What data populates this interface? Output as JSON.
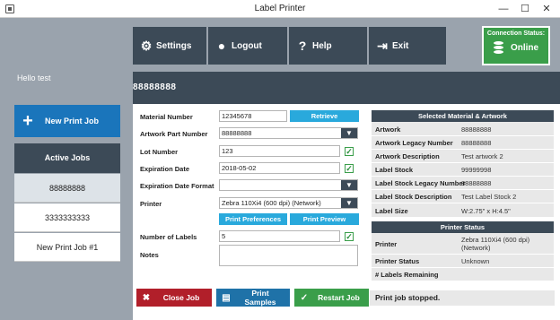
{
  "window": {
    "title": "Label Printer",
    "minimize": "—",
    "maximize": "☐",
    "close": "✕"
  },
  "sidebar": {
    "greeting": "Hello test",
    "new_job_label": "New Print Job",
    "active_jobs_title": "Active Jobs",
    "jobs": [
      "88888888",
      "3333333333",
      "New Print Job #1"
    ]
  },
  "toolbar": {
    "settings": "Settings",
    "logout": "Logout",
    "help": "Help",
    "exit": "Exit"
  },
  "connection": {
    "caption": "Connection Status:",
    "status": "Online",
    "color": "#3a9e4a"
  },
  "job_header": "88888888",
  "form": {
    "material_number": {
      "label": "Material Number",
      "value": "12345678",
      "button": "Retrieve"
    },
    "artwork_part_number": {
      "label": "Artwork Part Number",
      "value": "88888888"
    },
    "lot_number": {
      "label": "Lot Number",
      "value": "123"
    },
    "expiration_date": {
      "label": "Expiration Date",
      "value": "2018-05-02"
    },
    "expiration_date_format": {
      "label": "Expiration Date Format",
      "value": ""
    },
    "printer": {
      "label": "Printer",
      "value": "Zebra 110Xi4 (600 dpi) (Network)"
    },
    "print_preferences": "Print Preferences",
    "print_preview": "Print Preview",
    "number_of_labels": {
      "label": "Number of Labels",
      "value": "5"
    },
    "notes": {
      "label": "Notes",
      "value": ""
    }
  },
  "selected_material": {
    "title": "Selected Material & Artwork",
    "rows": [
      {
        "key": "Artwork",
        "value": "88888888"
      },
      {
        "key": "Artwork Legacy Number",
        "value": "88888888"
      },
      {
        "key": "Artwork Description",
        "value": "Test artwork 2"
      },
      {
        "key": "Label Stock",
        "value": "99999998"
      },
      {
        "key": "Label Stock Legacy Number",
        "value": "88888888"
      },
      {
        "key": "Label Stock Description",
        "value": "Test Label Stock 2"
      },
      {
        "key": "Label Size",
        "value": "W:2.75\" x H:4.5\""
      }
    ]
  },
  "printer_status": {
    "title": "Printer Status",
    "rows": [
      {
        "key": "Printer",
        "value": "Zebra 110Xi4 (600 dpi) (Network)"
      },
      {
        "key": "Printer Status",
        "value": "Unknown"
      },
      {
        "key": "# Labels Remaining",
        "value": ""
      }
    ]
  },
  "actions": {
    "close_job": "Close Job",
    "print_samples": "Print Samples",
    "restart_job": "Restart Job",
    "status_message": "Print job stopped."
  },
  "colors": {
    "dark": "#3c4a57",
    "blue": "#1a75bb",
    "light_blue": "#29a9dc",
    "red": "#b11f2a",
    "teal": "#1f72a8",
    "green": "#3a9e4a"
  }
}
